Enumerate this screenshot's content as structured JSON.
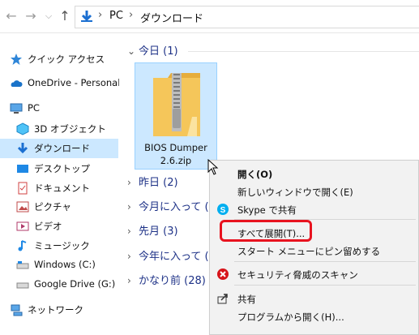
{
  "address": {
    "crumbs": [
      "PC",
      "ダウンロード"
    ]
  },
  "nav": {
    "quick_access": "クイック アクセス",
    "onedrive": "OneDrive - Personal",
    "pc": "PC",
    "objects3d": "3D オブジェクト",
    "downloads": "ダウンロード",
    "desktop": "デスクトップ",
    "documents": "ドキュメント",
    "pictures": "ピクチャ",
    "videos": "ビデオ",
    "music": "ミュージック",
    "windows_c": "Windows (C:)",
    "gdrive": "Google Drive (G:)",
    "network": "ネットワーク"
  },
  "groups": {
    "today": "今日 (1)",
    "yesterday": "昨日 (2)",
    "this_month": "今月に入って (",
    "last_month": "先月 (3)",
    "this_year": "今年に入って (",
    "long_ago": "かなり前 (28)"
  },
  "file": {
    "name_line1": "BIOS Dumper",
    "name_line2": "2.6.zip"
  },
  "menu": {
    "open": "開く(O)",
    "open_new_window": "新しいウィンドウで開く(E)",
    "skype_share": "Skype で共有",
    "extract_all": "すべて展開(T)...",
    "pin_start": "スタート メニューにピン留めする",
    "security_scan": "セキュリティ脅威のスキャン",
    "share": "共有",
    "open_with": "プログラムから開く(H)..."
  },
  "colors": {
    "accent": "#1e3287",
    "selection": "#cce8ff",
    "highlight": "#e8131f"
  }
}
